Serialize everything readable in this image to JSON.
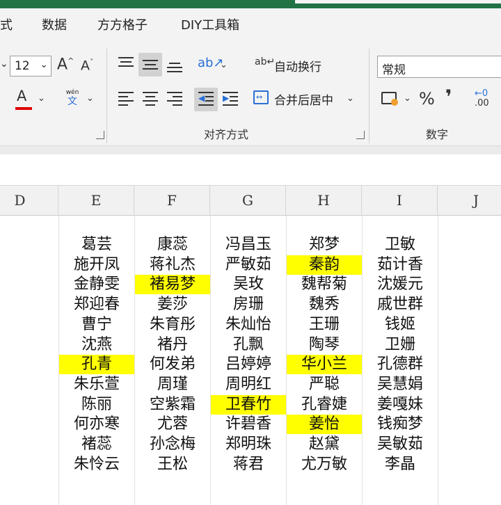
{
  "tabs": [
    "式",
    "数据",
    "方方格子",
    "DIY工具箱"
  ],
  "font": {
    "size_value": "12",
    "grow_label": "A",
    "shrink_label": "A",
    "color_label": "A",
    "font_color": "#e00000",
    "phonetic_top": "wén",
    "phonetic_bottom": "文"
  },
  "alignment": {
    "wrap_text_label": "自动换行",
    "merge_center_label": "合并后居中",
    "group_label": "对齐方式",
    "orientation_icon": "ab-diagonal-icon",
    "wrap_icon": "ab-wrap-icon"
  },
  "number": {
    "format_value": "常规",
    "percent_label": "%",
    "comma_label": "❜",
    "decimal_label": ".00",
    "group_label": "数字"
  },
  "colors": {
    "accent": "#217346",
    "highlight": "#ffff00"
  },
  "columns": [
    "D",
    "E",
    "F",
    "G",
    "H",
    "I",
    "J"
  ],
  "rows": [
    [
      "",
      "葛芸",
      "康蕊",
      "冯昌玉",
      "郑梦",
      "卫敏",
      ""
    ],
    [
      "",
      "施开凤",
      "蒋礼杰",
      "严敏茹",
      "秦韵",
      "茹计香",
      ""
    ],
    [
      "",
      "金静雯",
      "褚易梦",
      "吴玫",
      "魏帮菊",
      "沈媛元",
      ""
    ],
    [
      "",
      "郑迎春",
      "姜莎",
      "房珊",
      "魏秀",
      "戚世群",
      ""
    ],
    [
      "",
      "曹宁",
      "朱育彤",
      "朱灿怡",
      "王珊",
      "钱姬",
      ""
    ],
    [
      "",
      "沈燕",
      "褚丹",
      "孔飘",
      "陶琴",
      "卫姗",
      ""
    ],
    [
      "",
      "孔青",
      "何发弟",
      "吕婷婷",
      "华小兰",
      "孔德群",
      ""
    ],
    [
      "",
      "朱乐萱",
      "周瑾",
      "周明红",
      "严聪",
      "吴慧娟",
      ""
    ],
    [
      "",
      "陈丽",
      "空紫霜",
      "卫春竹",
      "孔睿婕",
      "姜嘎妹",
      ""
    ],
    [
      "",
      "何亦寒",
      "尤蓉",
      "许碧香",
      "姜怡",
      "钱痴梦",
      ""
    ],
    [
      "",
      "褚蕊",
      "孙念梅",
      "郑明珠",
      "赵黛",
      "吴敏茹",
      ""
    ],
    [
      "",
      "朱怜云",
      "王松",
      "蒋君",
      "尤万敏",
      "李晶",
      ""
    ]
  ],
  "highlights": [
    [
      1,
      4
    ],
    [
      2,
      2
    ],
    [
      6,
      1
    ],
    [
      6,
      4
    ],
    [
      8,
      3
    ],
    [
      9,
      4
    ]
  ]
}
